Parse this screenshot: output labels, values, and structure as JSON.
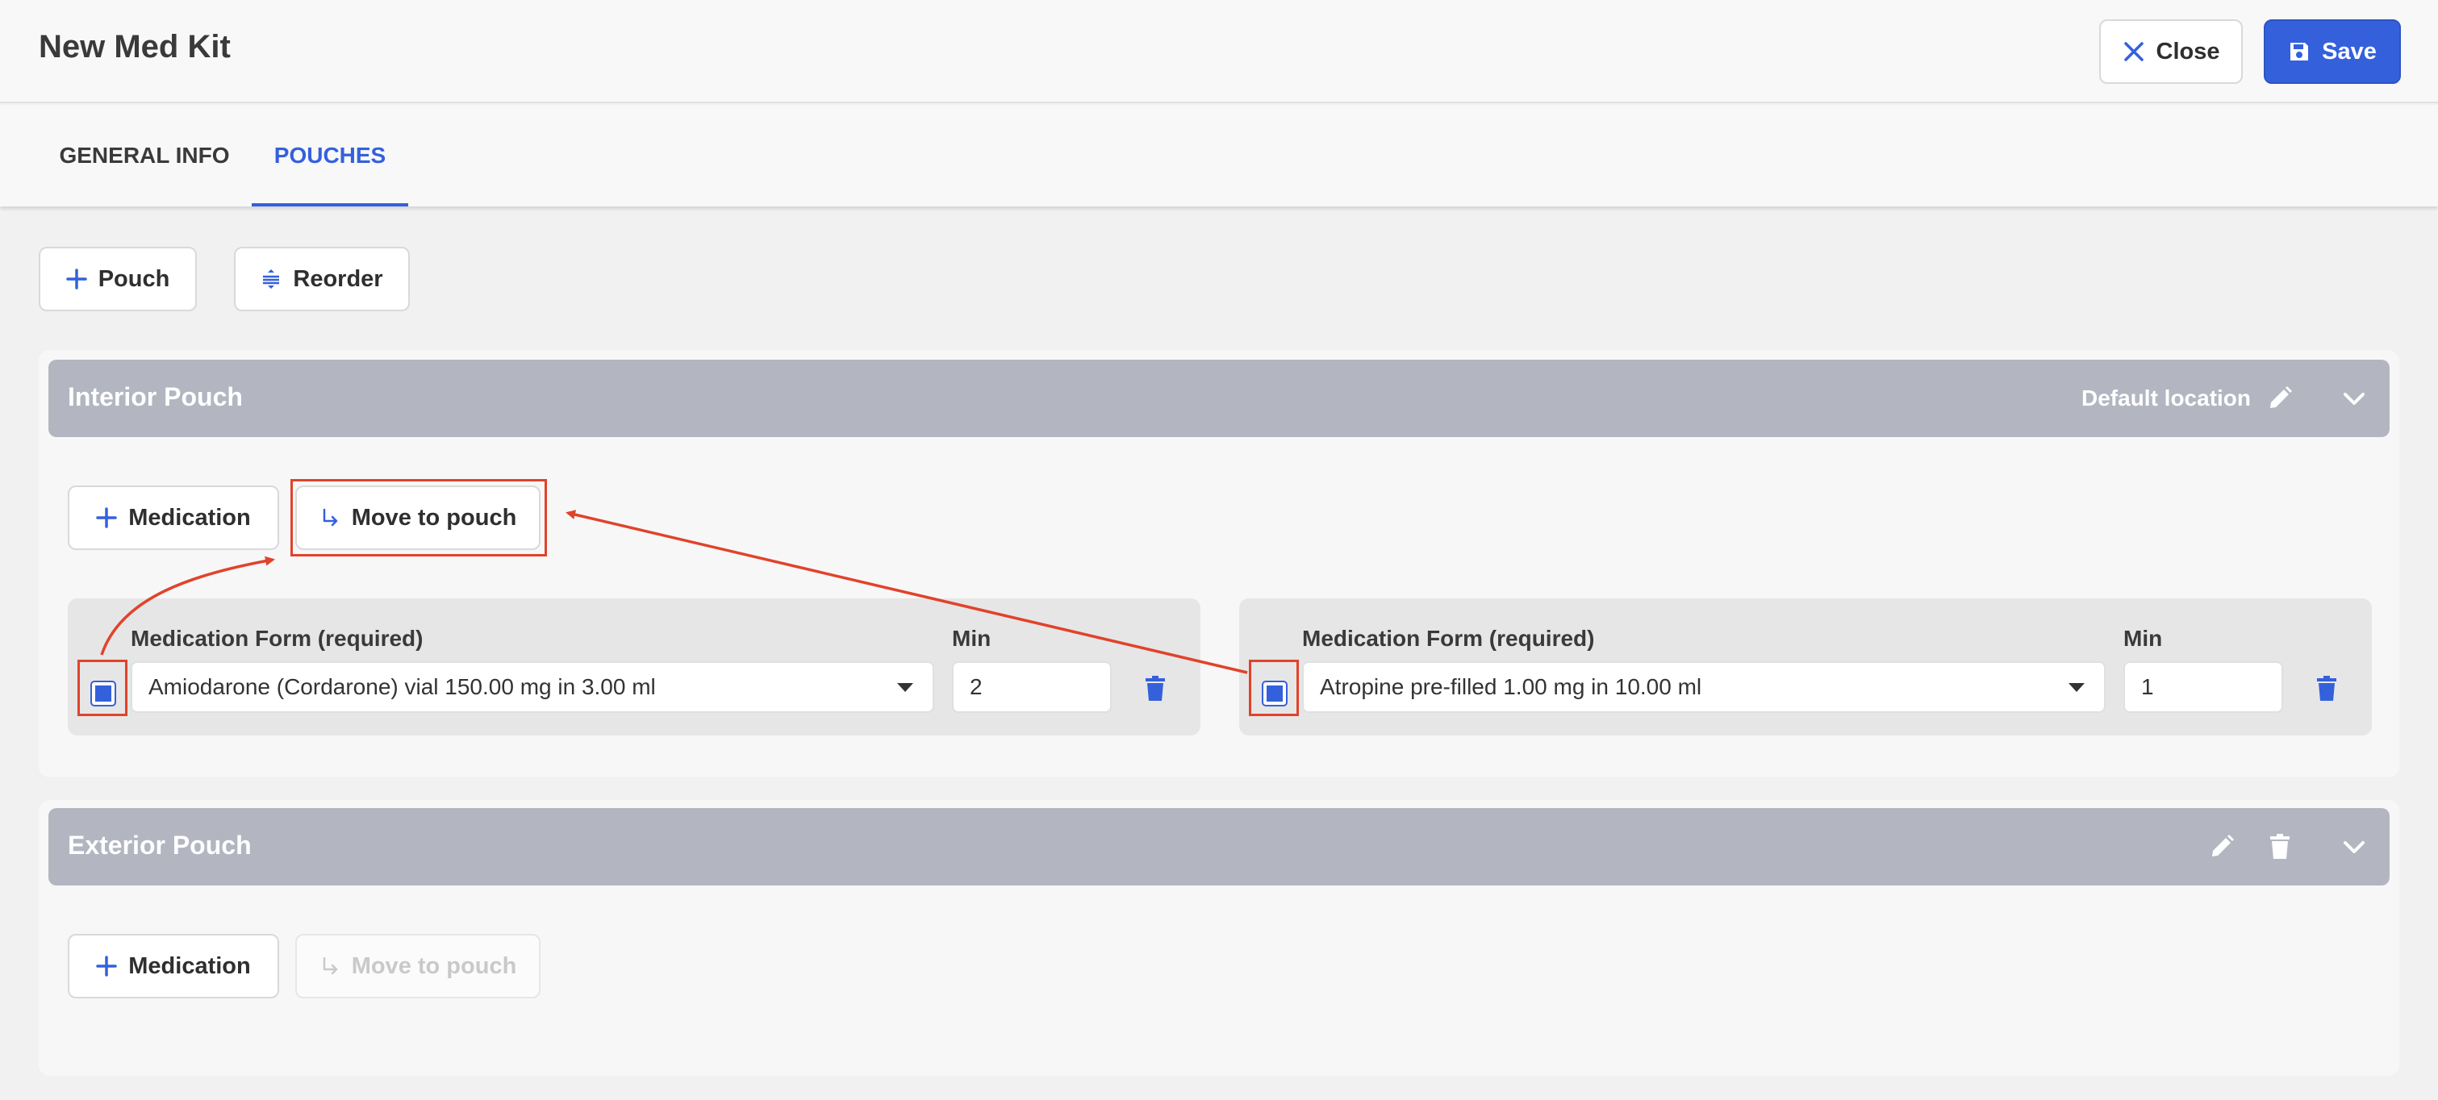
{
  "header": {
    "title": "New Med Kit",
    "close_label": "Close",
    "save_label": "Save"
  },
  "tabs": [
    {
      "label": "GENERAL INFO",
      "active": false
    },
    {
      "label": "POUCHES",
      "active": true
    }
  ],
  "toolbar": {
    "pouch_label": "Pouch",
    "reorder_label": "Reorder"
  },
  "pouches": [
    {
      "name": "Interior Pouch",
      "location": "Default location",
      "add_medication_label": "Medication",
      "move_to_pouch_label": "Move to pouch",
      "medications": [
        {
          "form_label": "Medication Form (required)",
          "form_value": "Amiodarone (Cordarone) vial 150.00 mg in 3.00 ml",
          "min_label": "Min",
          "min_value": "2",
          "selected": true
        },
        {
          "form_label": "Medication Form (required)",
          "form_value": "Atropine pre-filled 1.00 mg in 10.00 ml",
          "min_label": "Min",
          "min_value": "1",
          "selected": true
        }
      ]
    },
    {
      "name": "Exterior Pouch",
      "add_medication_label": "Medication",
      "move_to_pouch_label": "Move to pouch",
      "move_disabled": true
    }
  ],
  "colors": {
    "primary": "#3460dc",
    "pouch_header": "#b3b6c1",
    "annotation": "#e0432b"
  },
  "icons": {
    "close": "close-icon",
    "save": "floppy-disk-icon",
    "plus": "plus-icon",
    "reorder": "reorder-icon",
    "move": "arrow-return-right-icon",
    "edit": "pencil-icon",
    "delete": "trash-icon",
    "collapse": "chevron-down-icon"
  }
}
